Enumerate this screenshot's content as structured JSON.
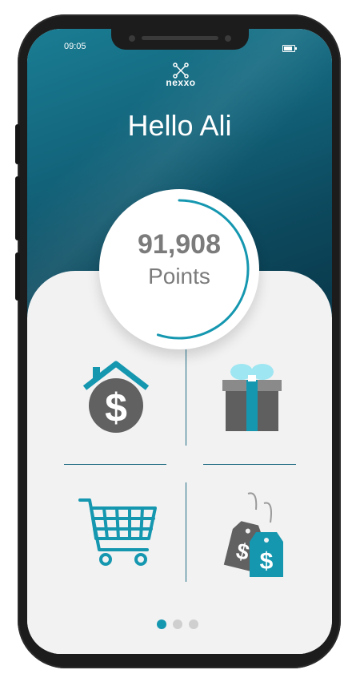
{
  "status_bar": {
    "time": "09:05"
  },
  "app": {
    "logo_text": "nexxo"
  },
  "greeting": "Hello Ali",
  "points": {
    "value": "91,908",
    "label": "Points",
    "progress_fraction": 0.55
  },
  "tiles": [
    {
      "name": "home-finance",
      "icon": "house-dollar-icon"
    },
    {
      "name": "gift",
      "icon": "gift-box-icon"
    },
    {
      "name": "shopping",
      "icon": "shopping-cart-icon"
    },
    {
      "name": "price-tags",
      "icon": "price-tag-dollar-icon"
    }
  ],
  "pagination": {
    "count": 3,
    "active_index": 0
  },
  "colors": {
    "teal": "#1597b0",
    "teal_dark": "#0d4a5f",
    "gray_icon": "#616161",
    "dot_inactive": "#cfcfcf",
    "background": "#f2f2f2"
  }
}
